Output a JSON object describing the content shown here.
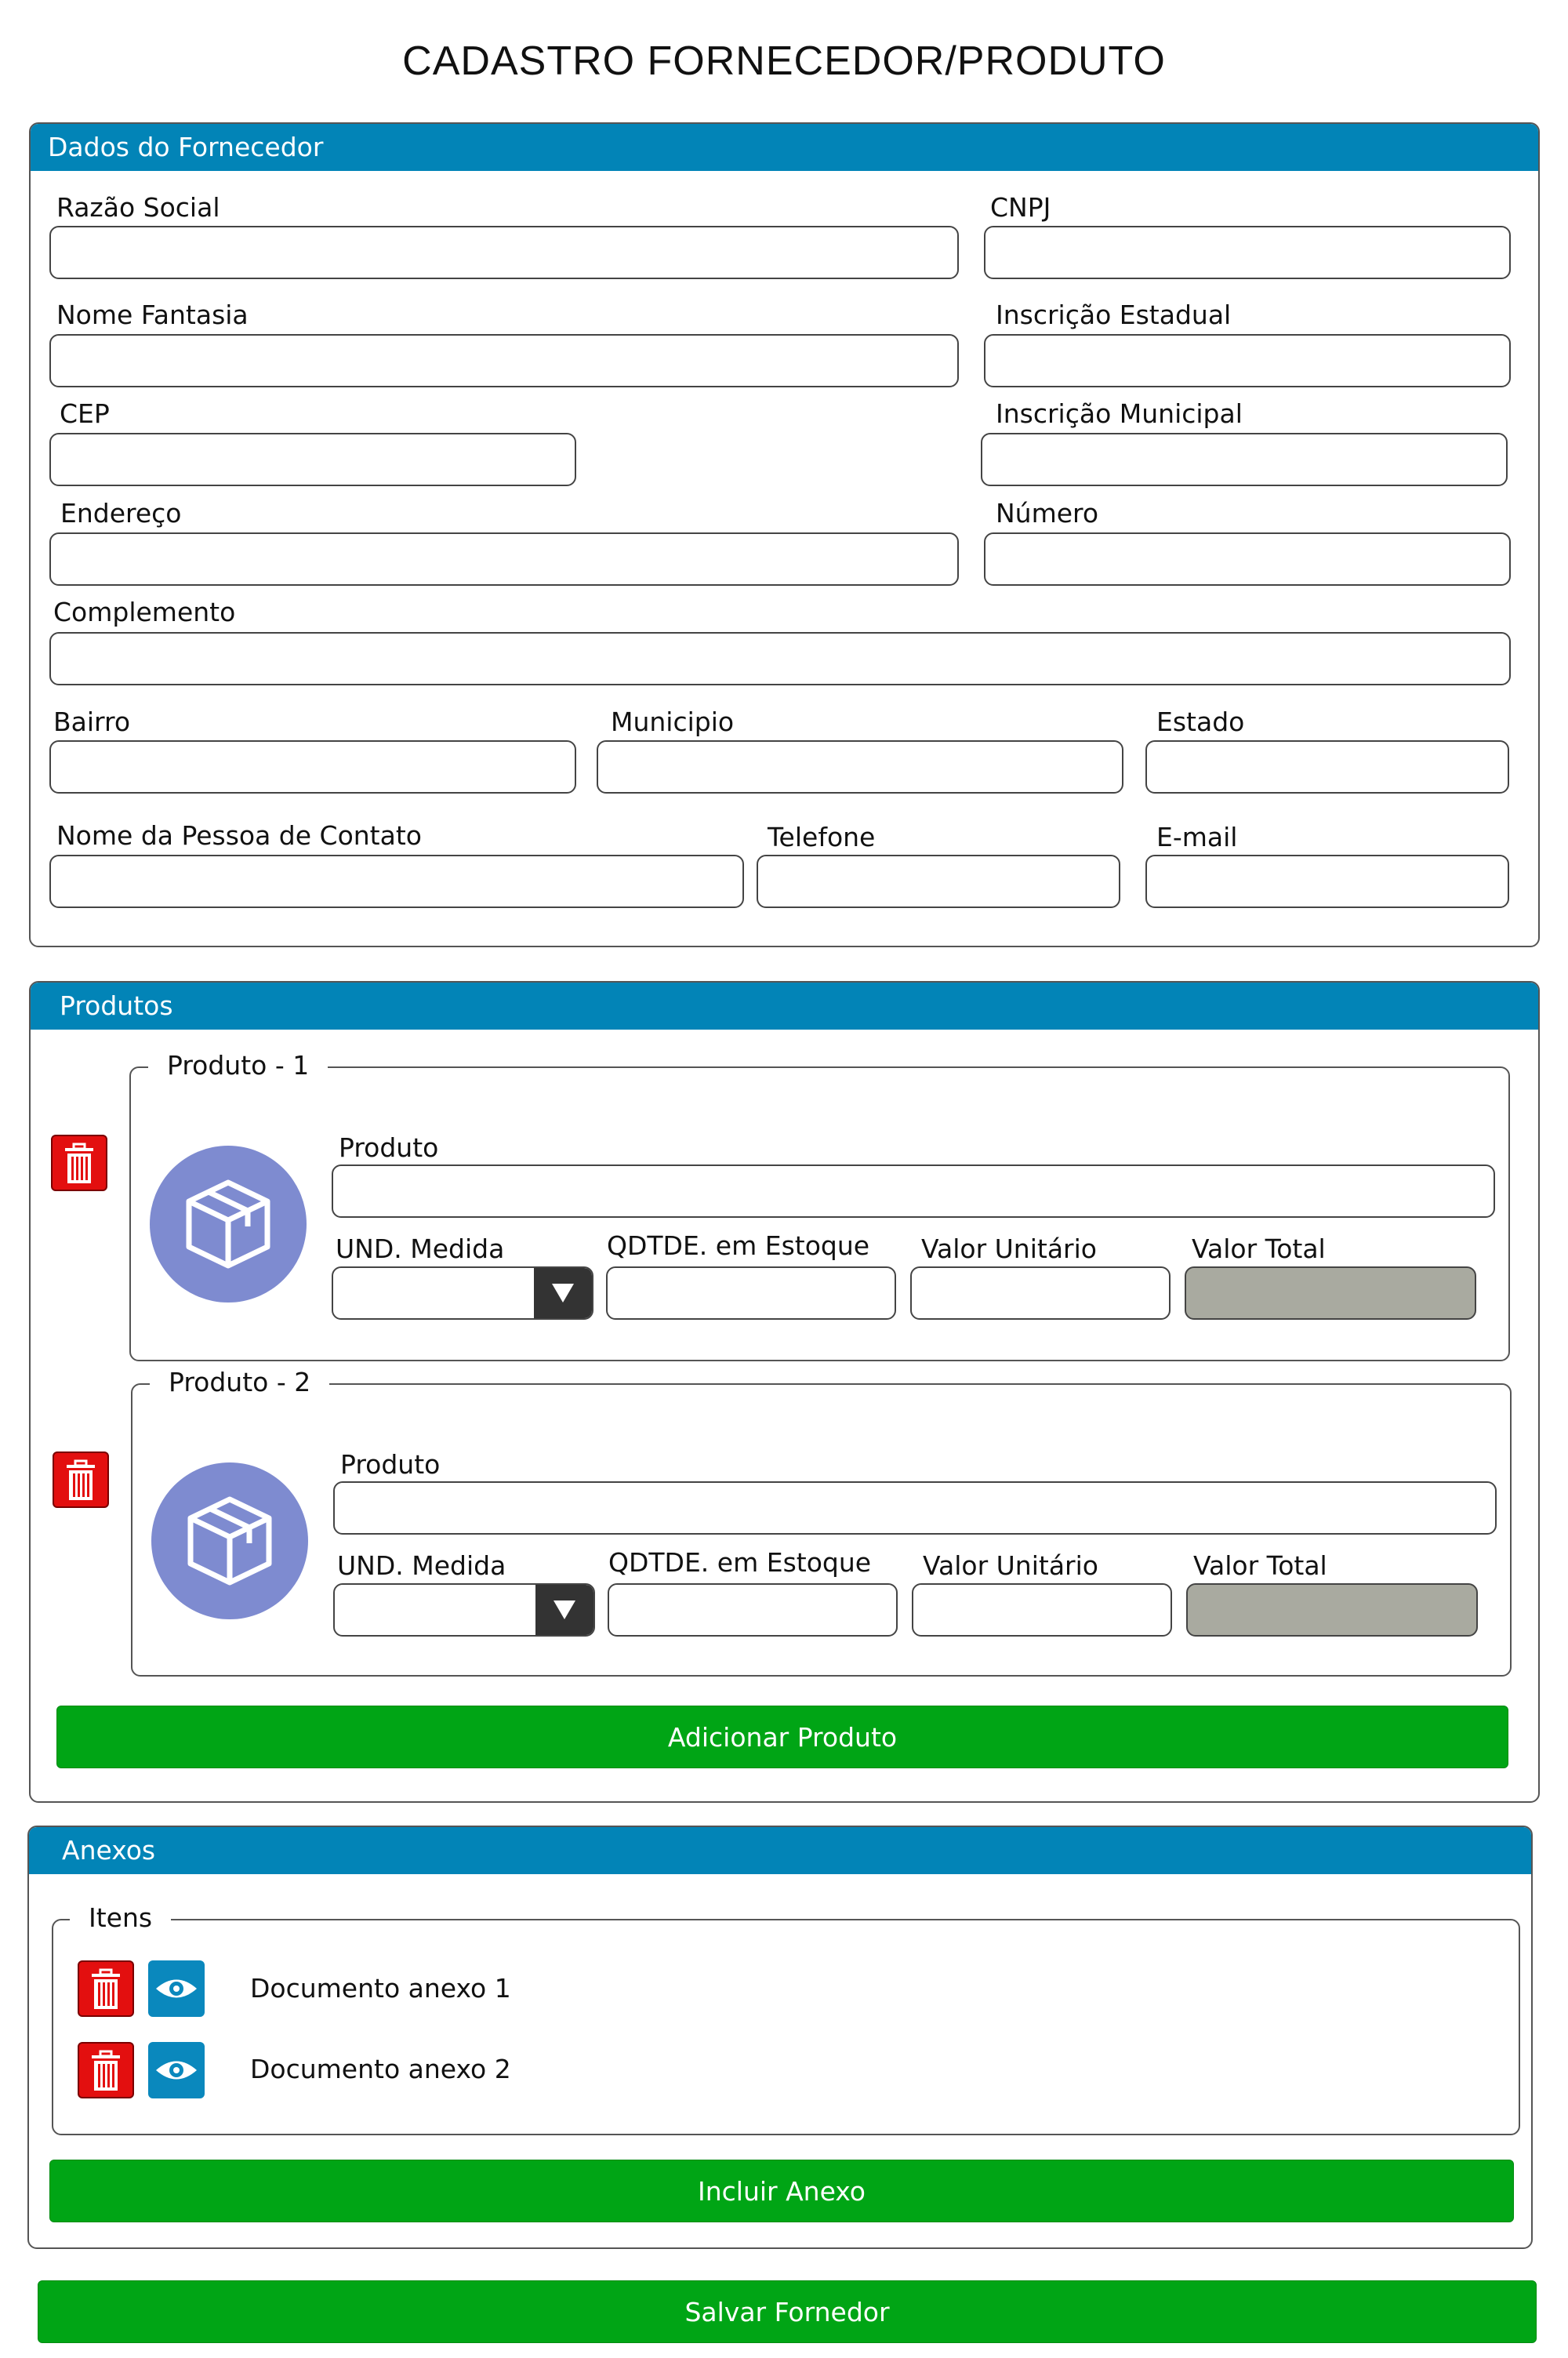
{
  "page": {
    "title": "CADASTRO FORNECEDOR/PRODUTO"
  },
  "supplier": {
    "header": "Dados do Fornecedor",
    "fields": {
      "razao_social": {
        "label": "Razão Social",
        "value": ""
      },
      "cnpj": {
        "label": "CNPJ",
        "value": ""
      },
      "nome_fantasia": {
        "label": "Nome Fantasia",
        "value": ""
      },
      "inscricao_estadual": {
        "label": "Inscrição Estadual",
        "value": ""
      },
      "cep": {
        "label": "CEP",
        "value": ""
      },
      "inscricao_municipal": {
        "label": "Inscrição Municipal",
        "value": ""
      },
      "endereco": {
        "label": "Endereço",
        "value": ""
      },
      "numero": {
        "label": "Número",
        "value": ""
      },
      "complemento": {
        "label": "Complemento",
        "value": ""
      },
      "bairro": {
        "label": "Bairro",
        "value": ""
      },
      "municipio": {
        "label": "Municipio",
        "value": ""
      },
      "estado": {
        "label": "Estado",
        "value": ""
      },
      "contato": {
        "label": "Nome da Pessoa de Contato",
        "value": ""
      },
      "telefone": {
        "label": "Telefone",
        "value": ""
      },
      "email": {
        "label": "E-mail",
        "value": ""
      }
    }
  },
  "products": {
    "header": "Produtos",
    "items": [
      {
        "legend": "Produto - 1",
        "produto_label": "Produto",
        "produto_value": "",
        "und_label": "UND. Medida",
        "und_value": "",
        "qtd_label": "QDTDE. em Estoque",
        "qtd_value": "",
        "unit_label": "Valor Unitário",
        "unit_value": "",
        "total_label": "Valor Total",
        "total_value": ""
      },
      {
        "legend": "Produto - 2",
        "produto_label": "Produto",
        "produto_value": "",
        "und_label": "UND. Medida",
        "und_value": "",
        "qtd_label": "QDTDE. em Estoque",
        "qtd_value": "",
        "unit_label": "Valor Unitário",
        "unit_value": "",
        "total_label": "Valor Total",
        "total_value": ""
      }
    ],
    "add_button": "Adicionar Produto"
  },
  "attachments": {
    "header": "Anexos",
    "legend": "Itens",
    "items": [
      {
        "name": "Documento anexo 1"
      },
      {
        "name": "Documento anexo 2"
      }
    ],
    "add_button": "Incluir Anexo"
  },
  "save_button": "Salvar Fornedor",
  "colors": {
    "header_blue": "#0284b7",
    "green": "#00a515",
    "danger_red": "#e30f0f",
    "avatar_purple": "#7e8bd0",
    "disabled_gray": "#a9aaa0"
  },
  "icons": [
    "trash-icon",
    "eye-icon",
    "package-icon",
    "triangle-down-icon"
  ]
}
